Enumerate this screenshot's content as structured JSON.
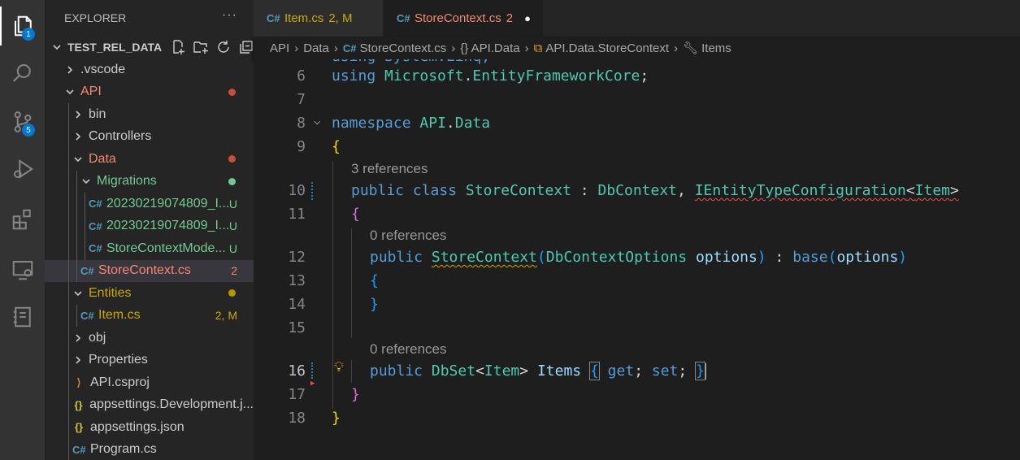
{
  "activity": {
    "explorer_badge": "1",
    "scm_badge": "5",
    "icons": [
      "files-icon",
      "search-icon",
      "source-control-icon",
      "run-debug-icon",
      "extensions-icon",
      "remote-explorer-icon",
      "notebook-icon"
    ]
  },
  "sidebar": {
    "title": "EXPLORER",
    "more": "···",
    "folder": "TEST_REL_DATA",
    "tree": [
      {
        "label": ".vscode",
        "type": "folder",
        "depth": 0,
        "expanded": false
      },
      {
        "label": "API",
        "type": "folder",
        "depth": 0,
        "expanded": true,
        "dot": "#c74e39"
      },
      {
        "label": "bin",
        "type": "folder",
        "depth": 1,
        "expanded": false
      },
      {
        "label": "Controllers",
        "type": "folder",
        "depth": 1,
        "expanded": false
      },
      {
        "label": "Data",
        "type": "folder",
        "depth": 1,
        "expanded": true,
        "dot": "#c74e39"
      },
      {
        "label": "Migrations",
        "type": "folder",
        "depth": 2,
        "expanded": true,
        "dot": "#73c991"
      },
      {
        "label": "20230219074809_I...",
        "type": "cs",
        "depth": 3,
        "decoration": "U"
      },
      {
        "label": "20230219074809_I...",
        "type": "cs",
        "depth": 3,
        "decoration": "U"
      },
      {
        "label": "StoreContextMode...",
        "type": "cs",
        "depth": 3,
        "decoration": "U"
      },
      {
        "label": "StoreContext.cs",
        "type": "cs",
        "depth": 2,
        "decoration": "2",
        "selected": true
      },
      {
        "label": "Entities",
        "type": "folder",
        "depth": 1,
        "expanded": true,
        "dot": "#b89500"
      },
      {
        "label": "Item.cs",
        "type": "cs",
        "depth": 2,
        "decoration": "2, M"
      },
      {
        "label": "obj",
        "type": "folder",
        "depth": 1,
        "expanded": false
      },
      {
        "label": "Properties",
        "type": "folder",
        "depth": 1,
        "expanded": false
      },
      {
        "label": "API.csproj",
        "type": "rss",
        "depth": 1
      },
      {
        "label": "appsettings.Development.j...",
        "type": "json",
        "depth": 1
      },
      {
        "label": "appsettings.json",
        "type": "json",
        "depth": 1
      },
      {
        "label": "Program.cs",
        "type": "cs",
        "depth": 1
      }
    ]
  },
  "tabs": [
    {
      "label": "Item.cs",
      "status": "2, M",
      "color": "#cca700"
    },
    {
      "label": "StoreContext.cs",
      "status": "2",
      "color": "#f48771",
      "modified_dot": "●"
    }
  ],
  "breadcrumb": [
    "API",
    "Data",
    "StoreContext.cs",
    "{} API.Data",
    "API.Data.StoreContext",
    "Items"
  ],
  "editor": {
    "lines": [
      "6",
      "7",
      "8",
      "9",
      "10",
      "11",
      "12",
      "13",
      "14",
      "15",
      "16",
      "17",
      "18"
    ],
    "lens_3": "3 references",
    "lens_0a": "0 references",
    "lens_0b": "0 references",
    "current_line": "16"
  }
}
